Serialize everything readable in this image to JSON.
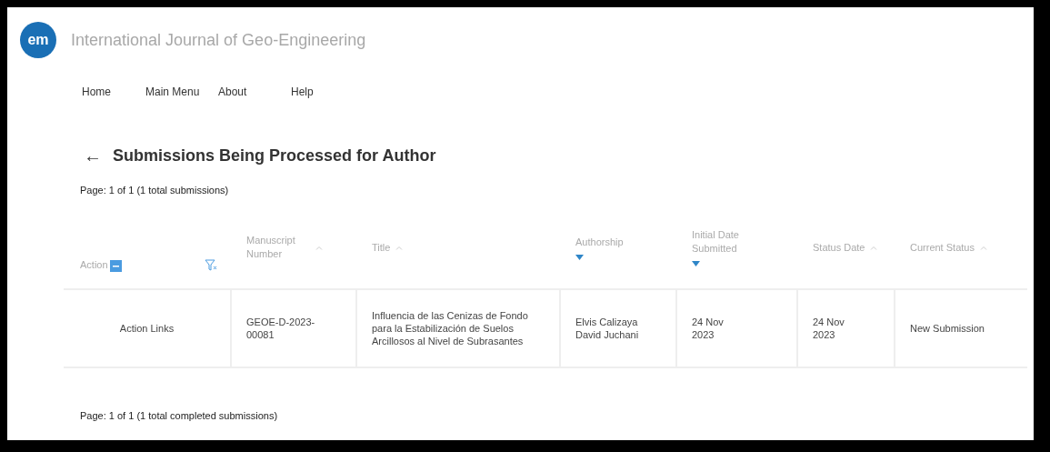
{
  "logo": {
    "text": "em"
  },
  "journal_title": "International Journal of Geo-Engineering",
  "nav": [
    "Home",
    "Main Menu",
    "About",
    "Help"
  ],
  "heading": {
    "back": "←",
    "title": "Submissions Being Processed for Author"
  },
  "page_info_top": "Page: 1 of 1 (1 total submissions)",
  "table": {
    "columns": [
      {
        "label": "Action",
        "kind": "action"
      },
      {
        "label": "Manuscript Number",
        "kind": "sort",
        "sort_active": false
      },
      {
        "label": "Title",
        "kind": "sort",
        "sort_active": false
      },
      {
        "label": "Authorship",
        "kind": "sort",
        "sort_active": true
      },
      {
        "label": "Initial Date Submitted",
        "kind": "sort",
        "sort_active": true
      },
      {
        "label": "Status Date",
        "kind": "sort",
        "sort_active": false
      },
      {
        "label": "Current Status",
        "kind": "sort",
        "sort_active": false
      }
    ],
    "rows": [
      [
        "Action Links",
        "GEOE-D-2023-00081",
        "Influencia de las Cenizas de Fondo para la Estabilización de Suelos Arcillosos al Nivel de Subrasantes",
        "Elvis Calizaya David Juchani",
        "24 Nov 2023",
        "24 Nov 2023",
        "New Submission"
      ]
    ]
  },
  "page_info_bottom": "Page: 1 of 1 (1 total completed submissions)"
}
